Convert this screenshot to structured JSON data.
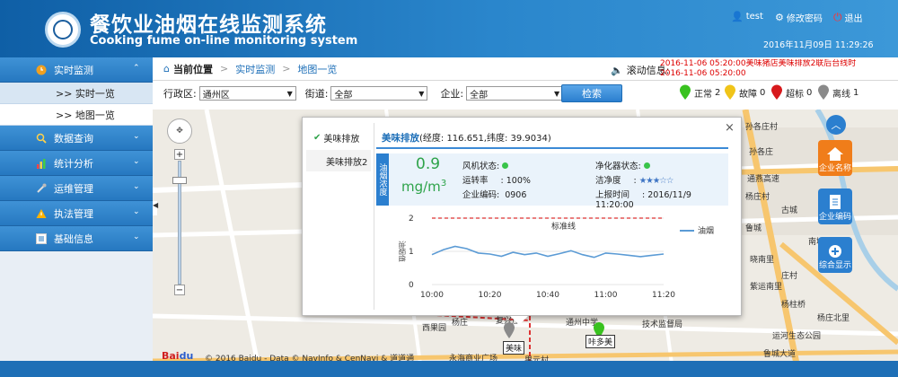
{
  "header": {
    "title_cn": "餐饮业油烟在线监测系统",
    "title_en": "Cooking fume on-line monitoring system",
    "user": "test",
    "change_password": "修改密码",
    "logout": "退出",
    "datetime": "2016年11月09日  11:29:26"
  },
  "sidebar": {
    "items": [
      {
        "label": "实时监测",
        "icon": "clock-icon"
      },
      {
        "label": "数据查询",
        "icon": "magnifier-icon"
      },
      {
        "label": "统计分析",
        "icon": "bar-chart-icon"
      },
      {
        "label": "运维管理",
        "icon": "tools-icon"
      },
      {
        "label": "执法管理",
        "icon": "warning-icon"
      },
      {
        "label": "基础信息",
        "icon": "list-icon"
      }
    ],
    "subitems": [
      {
        "label": ">>  实时一览"
      },
      {
        "label": ">>  地图一览"
      }
    ]
  },
  "breadcrumb": {
    "current_label": "当前位置",
    "path1": "实时监测",
    "path2": "地图一览"
  },
  "scroll": {
    "label": "滚动信息:",
    "line1": "2016-11-06 05:20:00美味猪店美味排放2联后台线时",
    "line2": "2016-11-06 05:20:00"
  },
  "filter": {
    "district_label": "行政区:",
    "district_value": "通州区",
    "street_label": "街道:",
    "street_value": "全部",
    "enterprise_label": "企业:",
    "enterprise_value": "全部",
    "search_button": "检索"
  },
  "legend": [
    {
      "label": "正常",
      "count": "2",
      "color": "#39c21f"
    },
    {
      "label": "故障",
      "count": "0",
      "color": "#f0c419"
    },
    {
      "label": "超标",
      "count": "0",
      "color": "#d7191c"
    },
    {
      "label": "离线",
      "count": "1",
      "color": "#8a8a8a"
    }
  ],
  "popup": {
    "tabs": [
      "美味排放",
      "美味排放2"
    ],
    "name": "美味排放",
    "coords": "(经度: 116.651,纬度: 39.9034)",
    "side_label": "油烟浓度",
    "value": "0.9",
    "unit_base": "mg/m",
    "unit_sup": "3",
    "fan_label": "风机状态:",
    "purifier_label": "净化器状态:",
    "run_rate_label": "运转率",
    "run_rate_value": ": 100%",
    "cleanliness_label": "洁净度",
    "cleanliness_sep": ":",
    "code_label": "企业编码:",
    "code_value": "0906",
    "report_label": "上报时间",
    "report_value": ": 2016/11/9 11:20:00",
    "close": "×",
    "stars_filled": 3,
    "stars_total": 5
  },
  "side_buttons": [
    {
      "label": "企业名称",
      "icon": "home-icon",
      "color": "#f07d1a"
    },
    {
      "label": "企业编码",
      "icon": "document-icon",
      "color": "#2b7fcf"
    },
    {
      "label": "综合显示",
      "icon": "plus-location-icon",
      "color": "#2b7fcf"
    }
  ],
  "map": {
    "attribution": "© 2016 Baidu - Data © NavInfo & CenNavi & 道道通",
    "place_labels": [
      "美味",
      "咔多美",
      "西果园",
      "杨庄",
      "复兴庄",
      "技术监督局",
      "永海商业广场",
      "果元村",
      "孙各庄村",
      "杨庄村",
      "古城",
      "鲁城",
      "运河生态公园",
      "通燕高速",
      "孙各庄",
      "杨柱桥",
      "紫运南里",
      "晓南里",
      "通州中学",
      "南城",
      "鲁城大道",
      "庄村",
      "杨庄北里"
    ],
    "colors": {
      "road": "#ffffff",
      "bg": "#eeebe4",
      "main_road": "#f7c66e"
    }
  },
  "chart_data": {
    "type": "line",
    "x": [
      "10:00",
      "10:20",
      "10:40",
      "11:00",
      "11:20"
    ],
    "series": [
      {
        "name": "油烟",
        "points": [
          [
            0,
            0.9
          ],
          [
            2,
            1.05
          ],
          [
            4,
            1.15
          ],
          [
            6,
            1.08
          ],
          [
            8,
            0.95
          ],
          [
            10,
            0.92
          ],
          [
            12,
            0.85
          ],
          [
            14,
            0.97
          ],
          [
            16,
            0.9
          ],
          [
            18,
            0.95
          ],
          [
            20,
            0.85
          ],
          [
            22,
            0.93
          ],
          [
            24,
            1.02
          ],
          [
            26,
            0.9
          ],
          [
            28,
            0.82
          ],
          [
            30,
            0.95
          ],
          [
            32,
            0.92
          ],
          [
            34,
            0.88
          ],
          [
            36,
            0.84
          ],
          [
            38,
            0.88
          ],
          [
            40,
            0.92
          ]
        ]
      }
    ],
    "threshold": {
      "label": "标准线",
      "value": 2
    },
    "ylabel": "油烟值",
    "ylim": [
      0,
      2
    ],
    "yticks": [
      "0",
      "1",
      "2"
    ]
  }
}
